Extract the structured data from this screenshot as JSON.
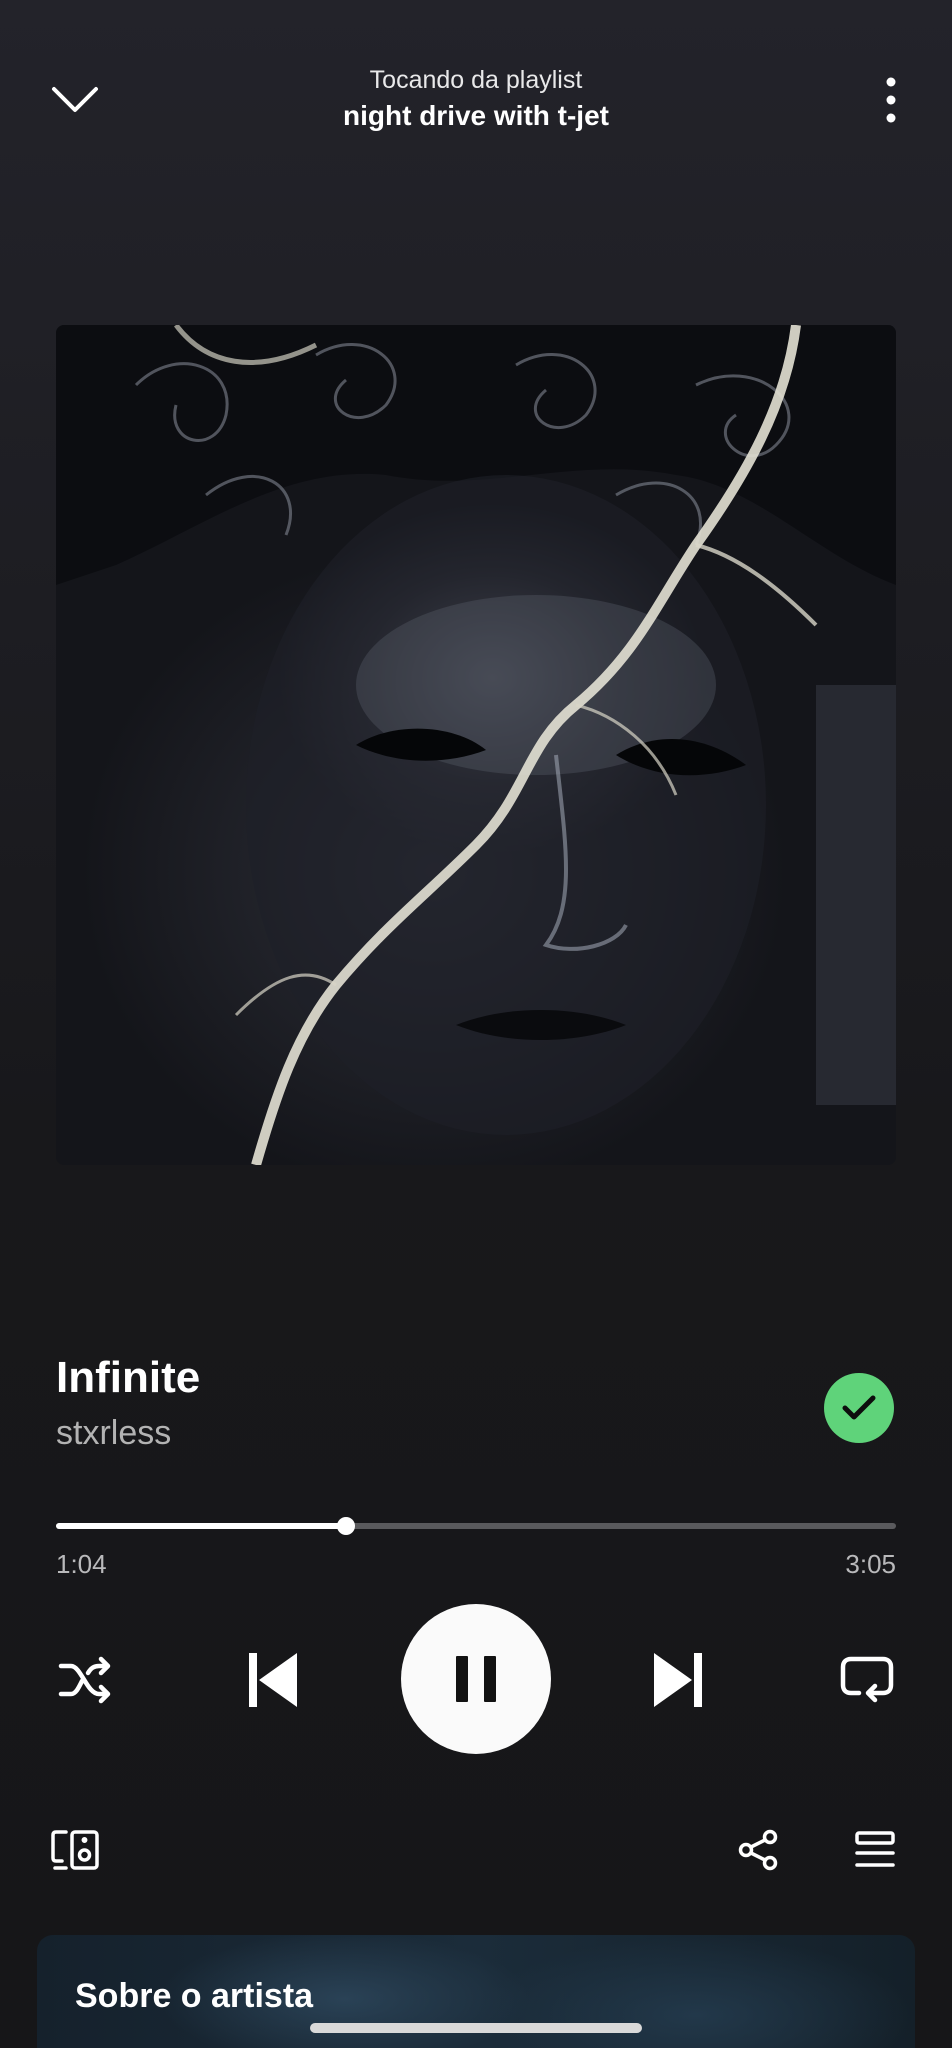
{
  "header": {
    "context_label": "Tocando da playlist",
    "playlist_name": "night drive with t-jet"
  },
  "track": {
    "title": "Infinite",
    "artist": "stxrless",
    "liked": true
  },
  "playback": {
    "elapsed": "1:04",
    "total": "3:05",
    "progress_fraction": 0.345,
    "state": "playing"
  },
  "artist_card": {
    "title": "Sobre o artista"
  },
  "icons": {
    "collapse": "chevron-down-icon",
    "more": "more-vertical-icon",
    "liked": "check-circle-icon",
    "shuffle": "shuffle-icon",
    "previous": "skip-previous-icon",
    "pause": "pause-icon",
    "next": "skip-next-icon",
    "repeat": "repeat-icon",
    "devices": "connect-devices-icon",
    "share": "share-icon",
    "queue": "queue-icon"
  },
  "colors": {
    "accent_liked": "#5fd37a",
    "background": "#161618",
    "text_secondary": "#b3b3b3"
  }
}
